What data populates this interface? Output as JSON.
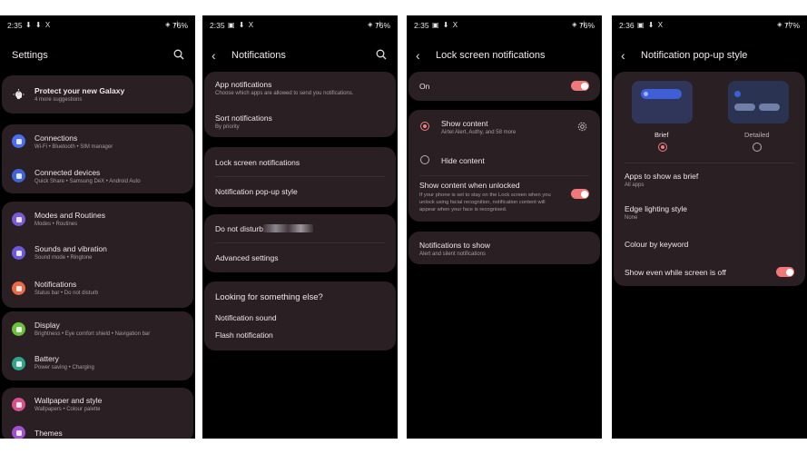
{
  "status": [
    {
      "time": "2:35",
      "notif": "⬇ ⬇ X",
      "battery": "76%"
    },
    {
      "time": "2:35",
      "notif": "▣ ⬇ X",
      "battery": "76%"
    },
    {
      "time": "2:35",
      "notif": "▣ ⬇ X",
      "battery": "76%"
    },
    {
      "time": "2:36",
      "notif": "▣ ⬇ X",
      "battery": "77%"
    }
  ],
  "settings": {
    "title": "Settings",
    "promo": {
      "title": "Protect your new Galaxy",
      "sub": "4 more suggestions"
    },
    "items": [
      {
        "label": "Connections",
        "sub": "Wi-Fi  •  Bluetooth  •  SIM manager",
        "color": "#4a6ef0"
      },
      {
        "label": "Connected devices",
        "sub": "Quick Share  •  Samsung DeX  •  Android Auto",
        "color": "#3f63d8"
      },
      {
        "label": "Modes and Routines",
        "sub": "Modes  •  Routines",
        "color": "#7b5ad6"
      },
      {
        "label": "Sounds and vibration",
        "sub": "Sound mode  •  Ringtone",
        "color": "#6b59d9"
      },
      {
        "label": "Notifications",
        "sub": "Status bar  •  Do not disturb",
        "color": "#e86a4a"
      },
      {
        "label": "Display",
        "sub": "Brightness  •  Eye comfort shield  •  Navigation bar",
        "color": "#6cbf3f"
      },
      {
        "label": "Battery",
        "sub": "Power saving  •  Charging",
        "color": "#2fa58e"
      },
      {
        "label": "Wallpaper and style",
        "sub": "Wallpapers  •  Colour palette",
        "color": "#d94f8a"
      },
      {
        "label": "Themes",
        "sub": "",
        "color": "#a24fd0"
      }
    ]
  },
  "notifications": {
    "title": "Notifications",
    "app": {
      "title": "App notifications",
      "sub": "Choose which apps are allowed to send you notifications."
    },
    "sort": {
      "title": "Sort notifications",
      "sub": "By priority"
    },
    "lock": "Lock screen notifications",
    "popup": "Notification pop-up style",
    "dnd": "Do not disturb",
    "advanced": "Advanced settings",
    "looking": "Looking for something else?",
    "sound": "Notification sound",
    "flash": "Flash notification"
  },
  "lockscreen": {
    "title": "Lock screen notifications",
    "on": "On",
    "show": {
      "title": "Show content",
      "sub": "Airtel Alert, Authy, and 58 more"
    },
    "hide": "Hide content",
    "unlocked": {
      "title": "Show content when unlocked",
      "sub": "If your phone is set to stay on the Lock screen when you unlock using facial recognition, notification content will appear when your face is recognised."
    },
    "toshow": {
      "title": "Notifications to show",
      "sub": "Alert and silent notifications"
    }
  },
  "popup": {
    "title": "Notification pop-up style",
    "brief": "Brief",
    "detailed": "Detailed",
    "apps": {
      "title": "Apps to show as brief",
      "sub": "All apps"
    },
    "edge": {
      "title": "Edge lighting style",
      "sub": "None"
    },
    "colour": "Colour by keyword",
    "screenoff": "Show even while screen is off"
  },
  "accent": "#f07878"
}
